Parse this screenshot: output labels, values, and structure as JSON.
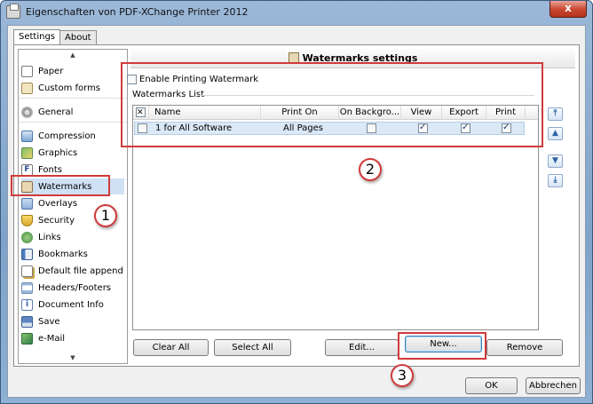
{
  "window": {
    "title": "Eigenschaften von PDF-XChange Printer 2012",
    "close_label": "x"
  },
  "tabs": [
    {
      "label": "Settings",
      "active": true
    },
    {
      "label": "About",
      "active": false
    }
  ],
  "nav": {
    "items": [
      {
        "label": "Paper",
        "icon": "paper-icon"
      },
      {
        "label": "Custom forms",
        "icon": "custom-forms-icon"
      },
      {
        "label": "General",
        "icon": "gears-icon"
      },
      {
        "label": "Compression",
        "icon": "compression-icon"
      },
      {
        "label": "Graphics",
        "icon": "graphics-icon"
      },
      {
        "label": "Fonts",
        "icon": "fonts-icon"
      },
      {
        "label": "Watermarks",
        "icon": "watermark-icon",
        "selected": true
      },
      {
        "label": "Overlays",
        "icon": "overlays-icon"
      },
      {
        "label": "Security",
        "icon": "shield-icon"
      },
      {
        "label": "Links",
        "icon": "globe-icon"
      },
      {
        "label": "Bookmarks",
        "icon": "bookmark-icon"
      },
      {
        "label": "Default file append",
        "icon": "file-append-icon"
      },
      {
        "label": "Headers/Footers",
        "icon": "header-footer-icon"
      },
      {
        "label": "Document Info",
        "icon": "info-icon"
      },
      {
        "label": "Save",
        "icon": "save-icon"
      },
      {
        "label": "e-Mail",
        "icon": "mail-icon"
      }
    ]
  },
  "panel": {
    "title": "Watermarks settings",
    "enable_label": "Enable Printing Watermark",
    "enable_checked": false,
    "list_label": "Watermarks List",
    "columns": [
      "Name",
      "Print On",
      "On Backgro...",
      "View",
      "Export",
      "Print"
    ],
    "rows": [
      {
        "name": "1 for All Software",
        "print_on": "All Pages",
        "on_background": false,
        "view": true,
        "export": true,
        "print": true
      }
    ]
  },
  "buttons": {
    "clear_all": "Clear All",
    "select_all": "Select All",
    "edit": "Edit...",
    "new": "New...",
    "remove": "Remove",
    "ok": "OK",
    "cancel": "Abbrechen"
  },
  "annotations": [
    "1",
    "2",
    "3"
  ],
  "colors": {
    "annotation": "#d03a3a",
    "selection": "#cfe1f4"
  }
}
